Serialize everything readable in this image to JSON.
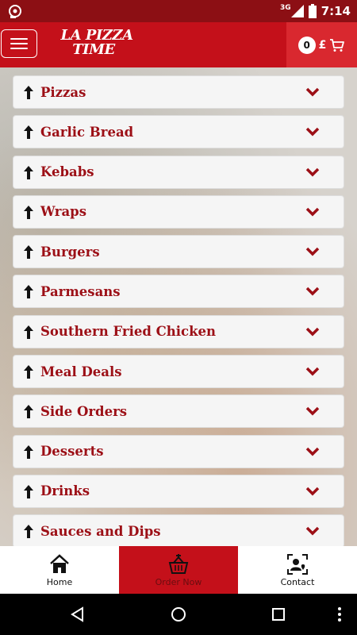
{
  "status_bar": {
    "network": "3G",
    "time": "7:14"
  },
  "app_bar": {
    "logo_line1": "LA PIZZA",
    "logo_line2": "TIME",
    "cart_count": "0",
    "currency_symbol": "£"
  },
  "categories": [
    {
      "label": "Pizzas"
    },
    {
      "label": "Garlic Bread"
    },
    {
      "label": "Kebabs"
    },
    {
      "label": "Wraps"
    },
    {
      "label": "Burgers"
    },
    {
      "label": "Parmesans"
    },
    {
      "label": "Southern Fried Chicken"
    },
    {
      "label": "Meal Deals"
    },
    {
      "label": "Side Orders"
    },
    {
      "label": "Desserts"
    },
    {
      "label": "Drinks"
    },
    {
      "label": "Sauces and Dips"
    }
  ],
  "bottom_nav": {
    "home": "Home",
    "order_now": "Order Now",
    "contact": "Contact"
  },
  "colors": {
    "brand_red": "#c4101a",
    "status_bar": "#8c0f14",
    "label_red": "#9c0f16"
  }
}
